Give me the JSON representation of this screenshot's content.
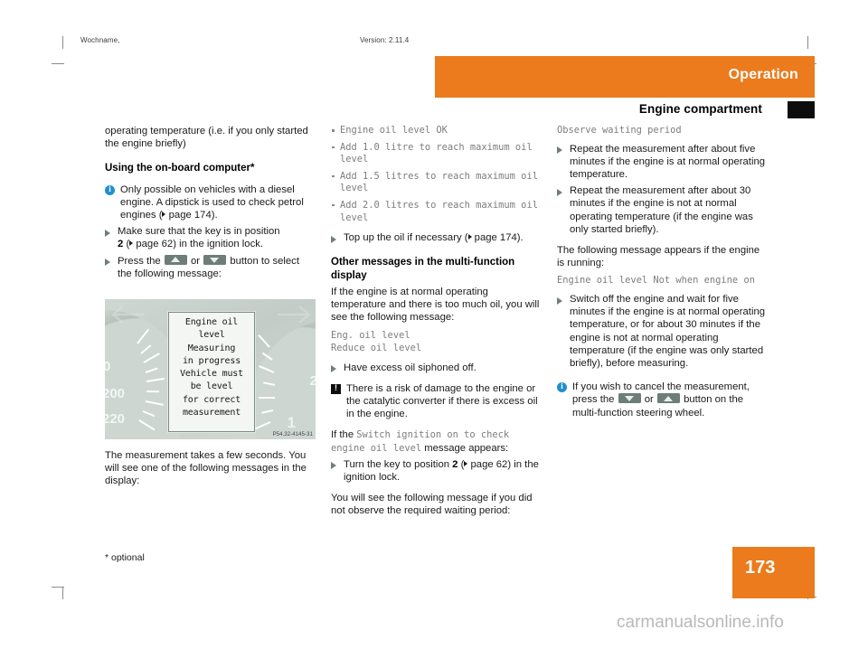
{
  "prepress": {
    "left": "Wochname,",
    "right": "Version: 2.11.4"
  },
  "header": {
    "chapter": "Operation",
    "section": "Engine compartment",
    "accent_color": "#eb7b1d",
    "tab_color": "#0d0d0d"
  },
  "col1": {
    "intro": "operating temperature (i.e. if you only started the engine briefly)",
    "heading": "Using the on-board computer",
    "heading_star": "*",
    "info_note": "Only possible on vehicles with a diesel engine. A dipstick is used to check petrol engines (",
    "info_note_ref": "page 174",
    "info_note_tail": ").",
    "step1_a": "Make sure that the key is in position",
    "step1_b": "2",
    "step1_c": "(",
    "step1_ref": "page 62",
    "step1_d": ") in the ignition lock.",
    "step2_a": "Press the",
    "step2_or": "or",
    "step2_b": "button to select the following message:",
    "after_figure": "The measurement takes a few seconds. You will see one of the following messages in the display:"
  },
  "figure": {
    "display_lines": [
      "Engine oil",
      "level",
      "Measuring",
      "in progress",
      "Vehicle must",
      "be level",
      "for correct",
      "measurement"
    ],
    "gauge_labels": [
      "0",
      "200",
      "220"
    ],
    "gear_indicator": "1",
    "code": "P54.32-4145-31"
  },
  "col2": {
    "messages": [
      "Engine oil level OK",
      "Add 1.0 litre to reach maximum oil level",
      "Add 1.5 litres to reach maximum oil level",
      "Add 2.0 litres to reach maximum oil level"
    ],
    "topup_a": "Top up the oil if necessary (",
    "topup_ref": "page 174",
    "topup_b": ").",
    "heading": "Other messages in the multi-function display",
    "para1": "If the engine is at normal operating temperature and there is too much oil, you will see the following message:",
    "msg_excess_1": "Eng. oil level",
    "msg_excess_2": "Reduce oil level",
    "step_siphon": "Have excess oil siphoned off.",
    "warn_note": "There is a risk of damage to the engine or the catalytic converter if there is excess oil in the engine.",
    "ifthe_a": "If the",
    "ifthe_msg": "Switch ignition on to check engine oil level",
    "ifthe_b": "message appears:",
    "step_key_a": "Turn the key to position",
    "step_key_b": "2",
    "step_key_c": "(",
    "step_key_ref": "page 62",
    "step_key_d": ") in the ignition lock.",
    "para_wait": "You will see the following message if you did not observe the required waiting period:"
  },
  "col3": {
    "msg_observe": "Observe waiting period",
    "step1": "Repeat the measurement after about five minutes if the engine is at normal operating temperature.",
    "step2": "Repeat the measurement after about 30 minutes if the engine is not at normal operating temperature (if the engine was only started briefly).",
    "para_running": "The following message appears if the engine is running:",
    "msg_notwhen": "Engine oil level Not when engine on",
    "step3": "Switch off the engine and wait for five minutes if the engine is at normal operating temperature, or for about 30 minutes if the engine is not at normal operating temperature (if the engine was only started briefly), before measuring.",
    "info_a": "If you wish to cancel the measurement, press the",
    "info_or": "or",
    "info_b": "button on the multi-function steering wheel."
  },
  "footer": {
    "footnote": "* optional",
    "page_number": "173",
    "watermark": "carmanualsonline.info"
  }
}
